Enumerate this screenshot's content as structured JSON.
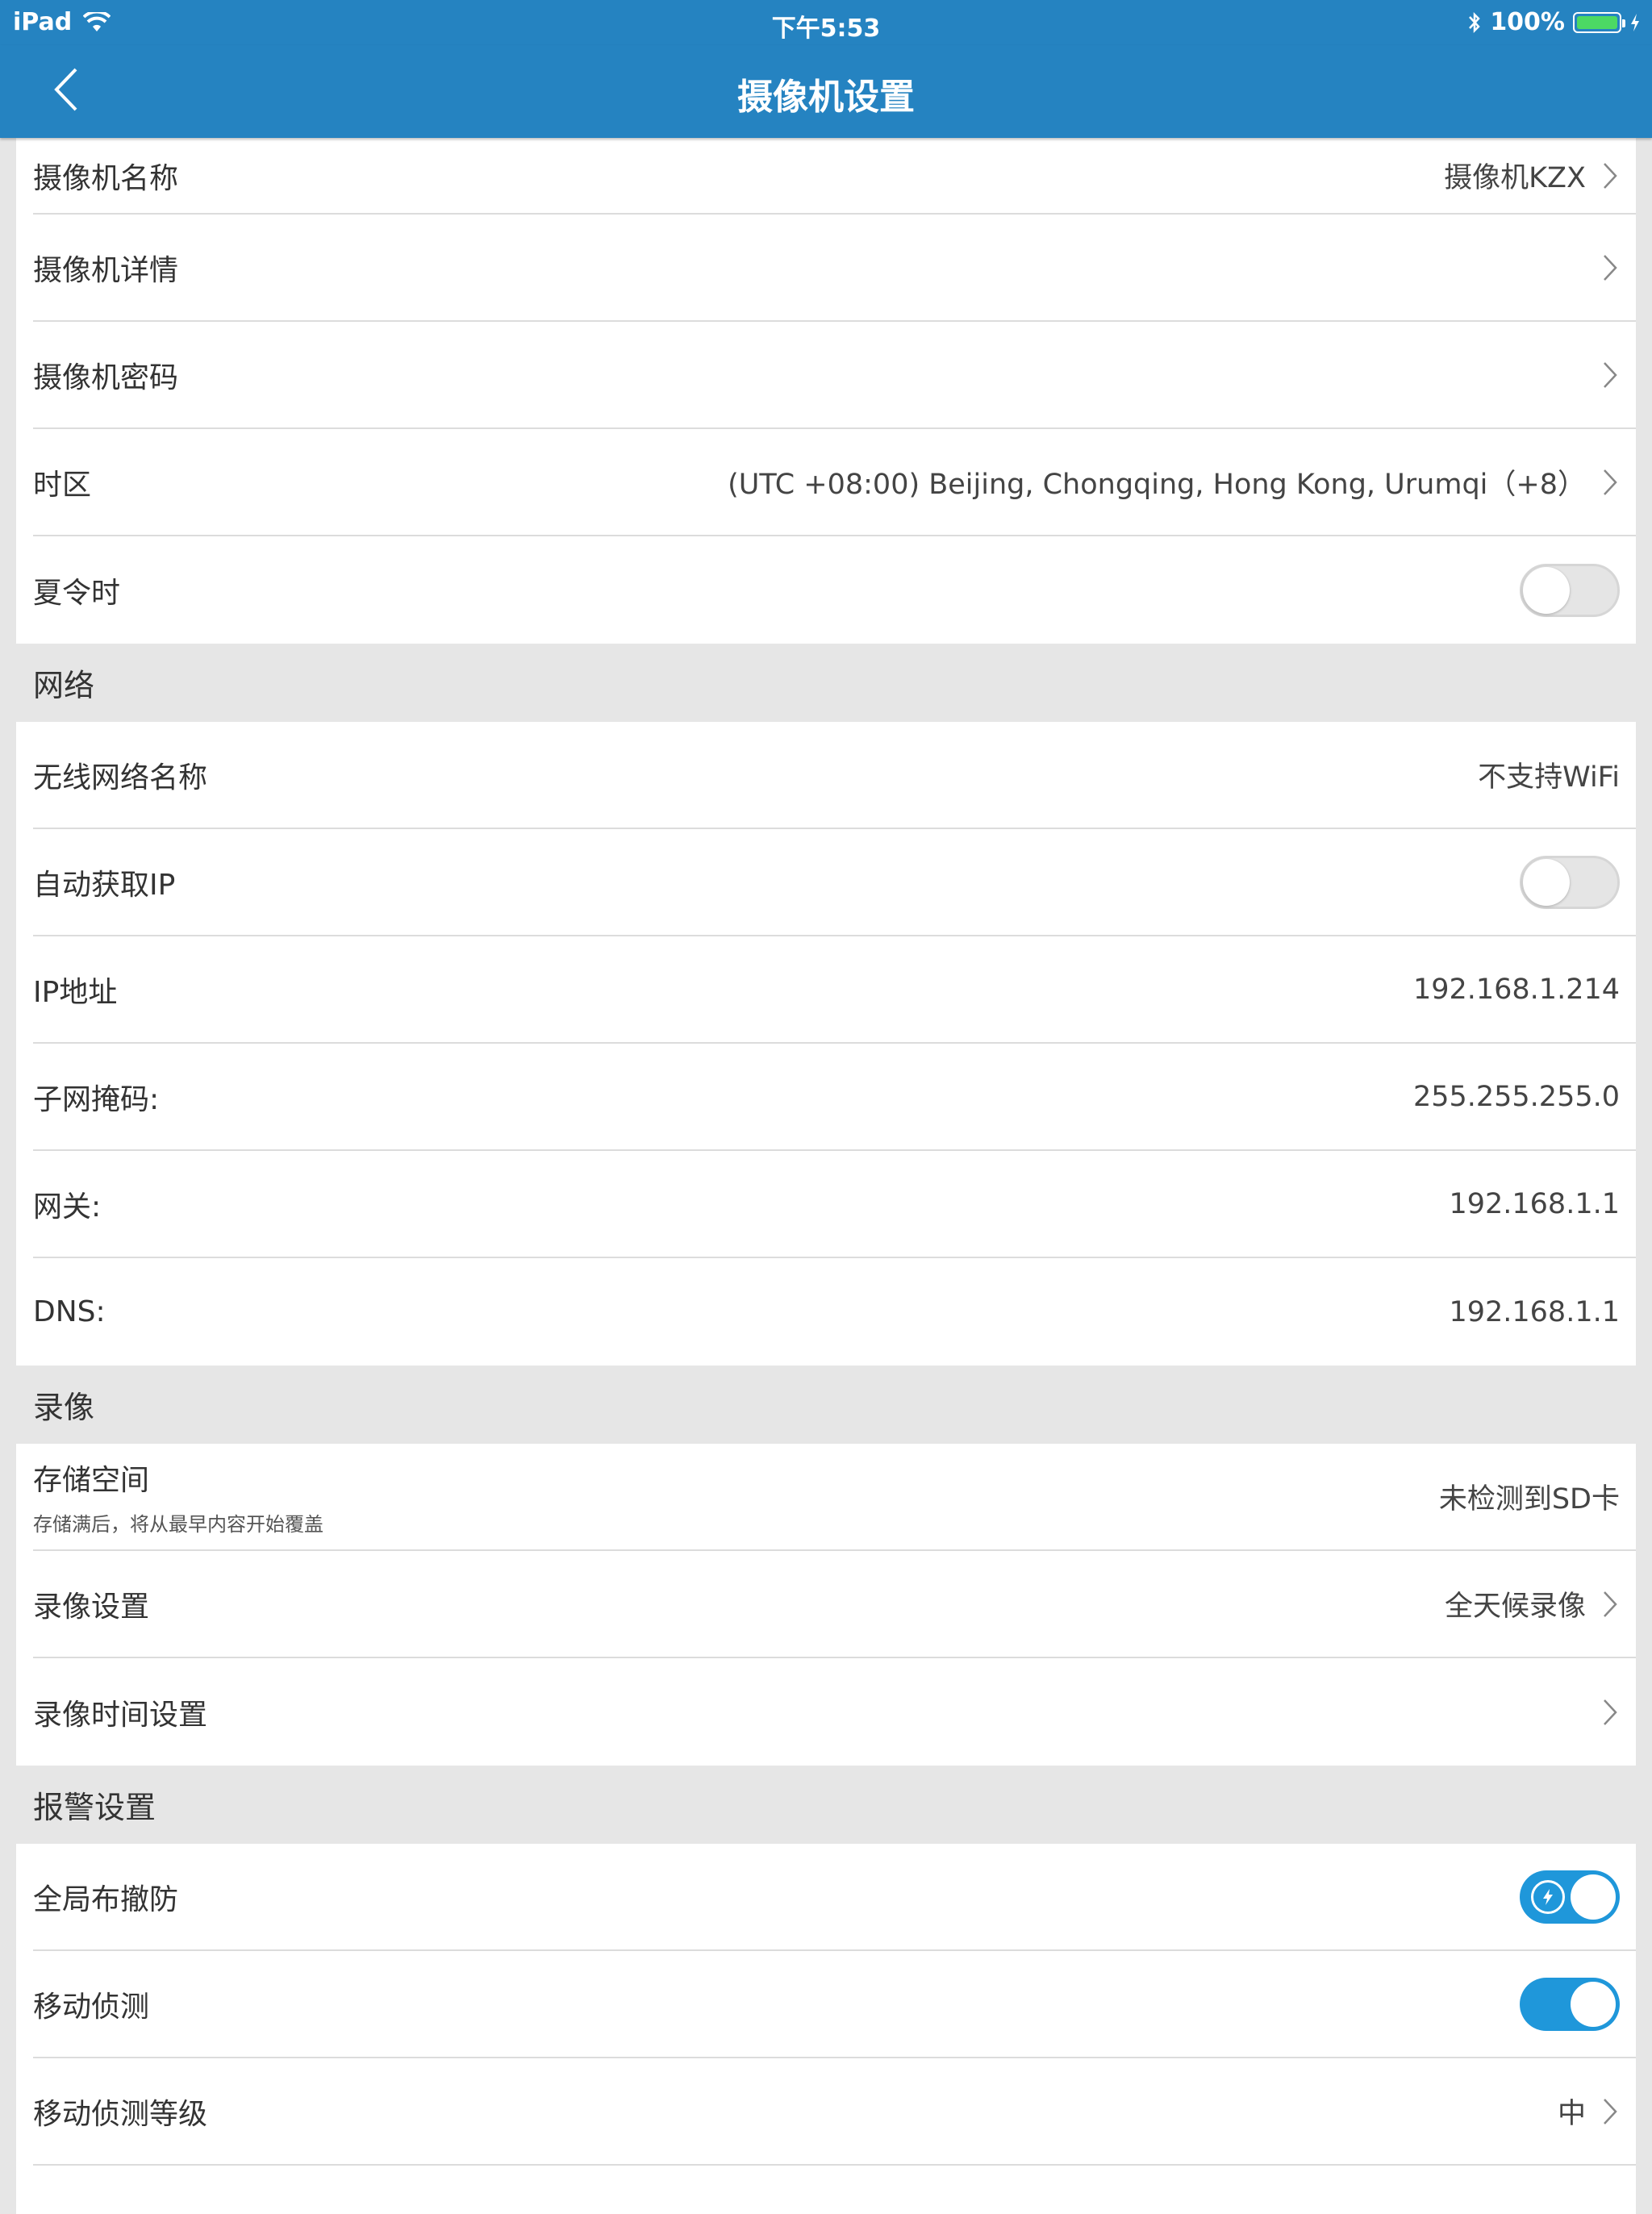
{
  "status_bar": {
    "device": "iPad",
    "time": "下午5:53",
    "battery_pct": "100%"
  },
  "nav": {
    "title": "摄像机设置"
  },
  "colors": {
    "nav_blue": "#2583c1",
    "toggle_on": "#1f97da",
    "battery_green": "#4cd964"
  },
  "general": {
    "camera_name": {
      "label": "摄像机名称",
      "value": "摄像机KZX"
    },
    "camera_details": {
      "label": "摄像机详情"
    },
    "camera_password": {
      "label": "摄像机密码"
    },
    "timezone": {
      "label": "时区",
      "value": "(UTC +08:00) Beijing, Chongqing, Hong Kong, Urumqi（+8）"
    },
    "dst": {
      "label": "夏令时",
      "on": false
    }
  },
  "network": {
    "header": "网络",
    "wifi_name": {
      "label": "无线网络名称",
      "value": "不支持WiFi"
    },
    "auto_ip": {
      "label": "自动获取IP",
      "on": false
    },
    "ip": {
      "label": "IP地址",
      "value": "192.168.1.214"
    },
    "subnet": {
      "label": "子网掩码:",
      "value": "255.255.255.0"
    },
    "gateway": {
      "label": "网关:",
      "value": "192.168.1.1"
    },
    "dns": {
      "label": "DNS:",
      "value": "192.168.1.1"
    }
  },
  "recording": {
    "header": "录像",
    "storage": {
      "label": "存储空间",
      "sub": "存储满后，将从最早内容开始覆盖",
      "value": "未检测到SD卡"
    },
    "record_settings": {
      "label": "录像设置",
      "value": "全天候录像"
    },
    "record_time_settings": {
      "label": "录像时间设置"
    }
  },
  "alarm": {
    "header": "报警设置",
    "global_arm": {
      "label": "全局布撤防",
      "on": true
    },
    "motion_detect": {
      "label": "移动侦测",
      "on": true
    },
    "motion_level": {
      "label": "移动侦测等级",
      "value": "中"
    }
  },
  "icons": [
    "wifi-icon",
    "bluetooth-icon",
    "battery-icon",
    "charging-bolt-icon",
    "back-chevron-icon",
    "chevron-right-icon",
    "shield-bolt-icon"
  ]
}
